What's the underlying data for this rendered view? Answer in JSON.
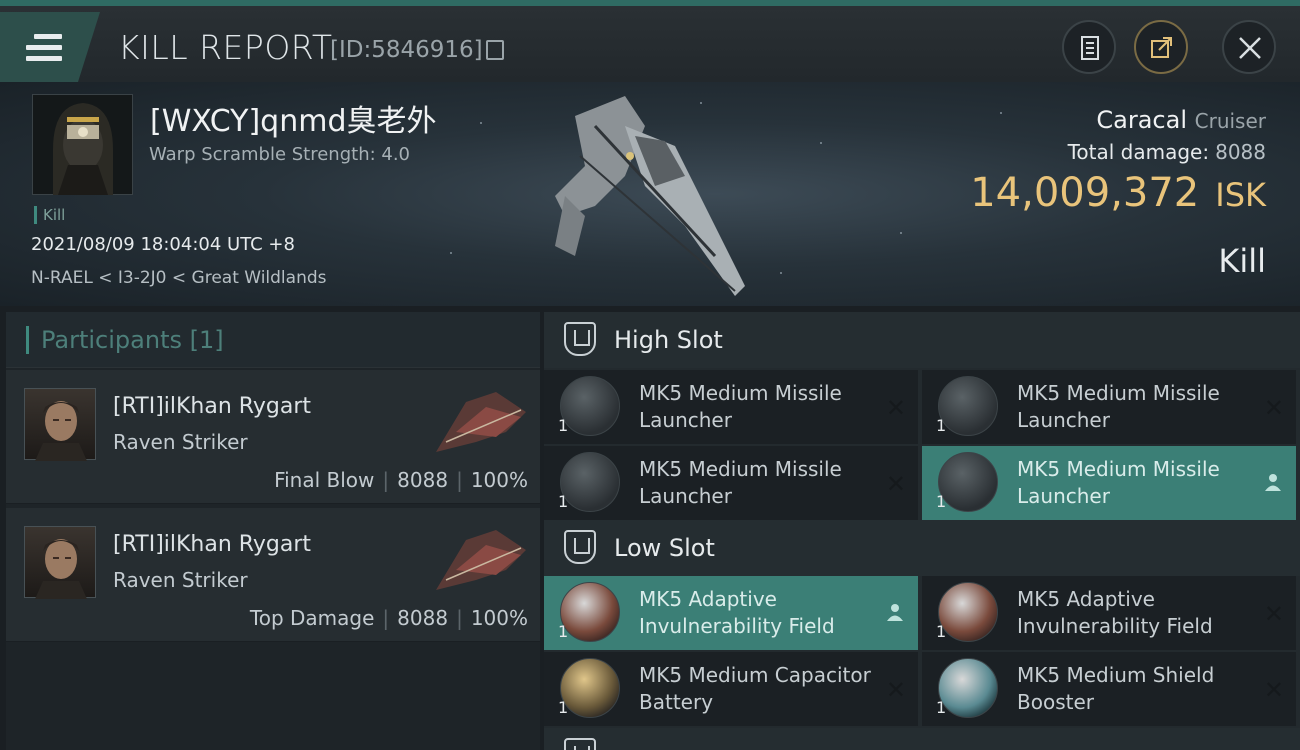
{
  "header": {
    "title": "KILL REPORT",
    "id": "[ID:5846916]"
  },
  "victim": {
    "name": "[WXCY]qnmd臭老外",
    "warp_scramble": "Warp Scramble Strength: 4.0",
    "tag": "Kill",
    "time": "2021/08/09 18:04:04 UTC +8",
    "location": "N-RAEL < I3-2J0 < Great Wildlands",
    "ship": "Caracal",
    "ship_class": "Cruiser",
    "total_damage_label": "Total damage:",
    "total_damage": "8088",
    "isk_value": "14,009,372",
    "isk_unit": "ISK",
    "result": "Kill"
  },
  "participants": {
    "title": "Participants [1]",
    "rows": [
      {
        "name": "[RTI]ilKhan Rygart",
        "ship": "Raven Striker",
        "role": "Final Blow",
        "damage": "8088",
        "percent": "100%"
      },
      {
        "name": "[RTI]ilKhan Rygart",
        "ship": "Raven Striker",
        "role": "Top Damage",
        "damage": "8088",
        "percent": "100%"
      }
    ]
  },
  "fitting": {
    "high_slot": {
      "title": "High Slot",
      "modules": [
        {
          "name": "MK5 Medium Missile Launcher",
          "qty": "1"
        },
        {
          "name": "MK5 Medium Missile Launcher",
          "qty": "1"
        },
        {
          "name": "MK5 Medium Missile Launcher",
          "qty": "1"
        },
        {
          "name": "MK5 Medium Missile Launcher",
          "qty": "1"
        }
      ]
    },
    "low_slot": {
      "title": "Low Slot",
      "modules": [
        {
          "name": "MK5 Adaptive Invulnerability Field",
          "qty": "1"
        },
        {
          "name": "MK5 Adaptive Invulnerability Field",
          "qty": "1"
        },
        {
          "name": "MK5 Medium Capacitor Battery",
          "qty": "1"
        },
        {
          "name": "MK5 Medium Shield Booster",
          "qty": "1"
        }
      ]
    }
  },
  "colors": {
    "accent": "#3f8a7f",
    "isk": "#e9c47b",
    "active_module": "#3b7f76"
  },
  "icons": [
    "menu-icon",
    "copy-icon",
    "notes-icon",
    "share-icon",
    "close-icon",
    "slot-icon",
    "remove-icon",
    "user-icon"
  ]
}
